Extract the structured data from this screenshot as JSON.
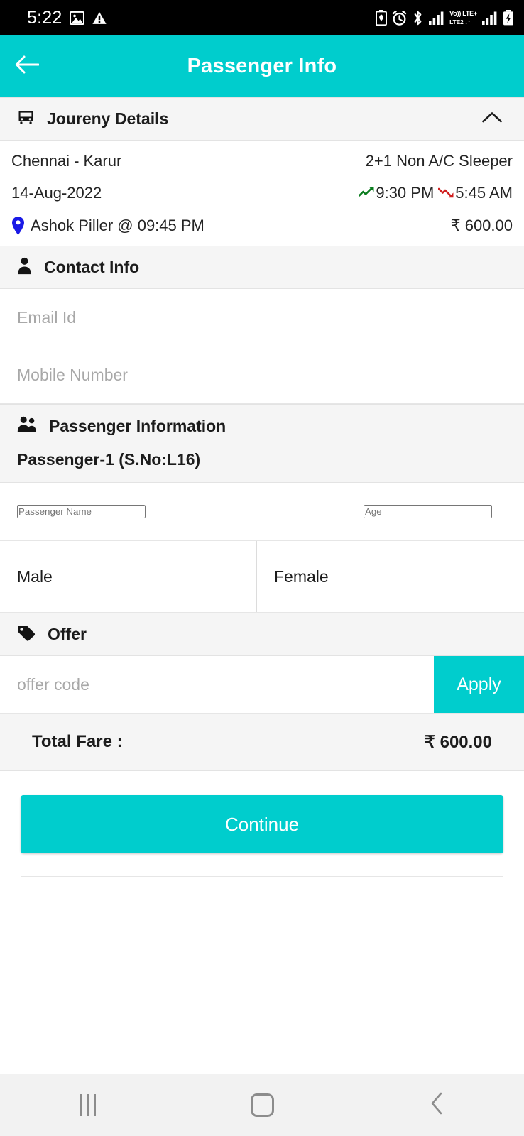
{
  "status_bar": {
    "time": "5:22",
    "left_icons": [
      "image-icon",
      "warning-icon"
    ],
    "right_icons": [
      "battery-saver-icon",
      "alarm-icon",
      "bluetooth-icon",
      "signal-bars-icon",
      "volte-icon",
      "signal-bars-2-icon",
      "battery-charging-icon"
    ],
    "network_primary": "LTE+",
    "network_volte": "Vo))",
    "network_secondary": "LTE2",
    "data_arrows": "↓↑"
  },
  "appbar": {
    "title": "Passenger Info",
    "back_icon": "arrow-left-icon",
    "bg_color": "#00cdcd"
  },
  "journey": {
    "header": {
      "title": "Joureny Details",
      "icon": "bus-icon",
      "collapse_icon": "chevron-up-icon"
    },
    "route": "Chennai - Karur",
    "bus_type": "2+1 Non A/C Sleeper",
    "date": "14-Aug-2022",
    "departure_time": "9:30 PM",
    "arrival_time": "5:45 AM",
    "boarding_point": "Ashok Piller @ 09:45 PM",
    "fare": "₹ 600.00",
    "depart_icon": "trending-up-icon",
    "arrive_icon": "trending-down-icon",
    "pin_icon": "map-pin-icon",
    "depart_color": "#0a7c1e",
    "arrive_color": "#d02020",
    "pin_color": "#1a1ae6"
  },
  "contact": {
    "header": {
      "title": "Contact Info",
      "icon": "person-icon"
    },
    "email": {
      "value": "",
      "placeholder": "Email Id"
    },
    "mobile": {
      "value": "",
      "placeholder": "Mobile Number"
    }
  },
  "passenger": {
    "header": {
      "title": "Passenger Information",
      "icon": "group-icon"
    },
    "label": "Passenger-1 (S.No:L16)",
    "name": {
      "value": "",
      "placeholder": "Passenger Name"
    },
    "age": {
      "value": "",
      "placeholder": "Age"
    },
    "gender_male": "Male",
    "gender_female": "Female"
  },
  "offer": {
    "header": {
      "title": "Offer",
      "icon": "tag-icon"
    },
    "code": {
      "value": "",
      "placeholder": "offer code"
    },
    "apply_label": "Apply"
  },
  "total": {
    "label": "Total Fare :",
    "value": "₹ 600.00"
  },
  "actions": {
    "continue_label": "Continue"
  },
  "navbar": {
    "recents": "recents-icon",
    "home": "home-icon",
    "back": "back-icon"
  }
}
